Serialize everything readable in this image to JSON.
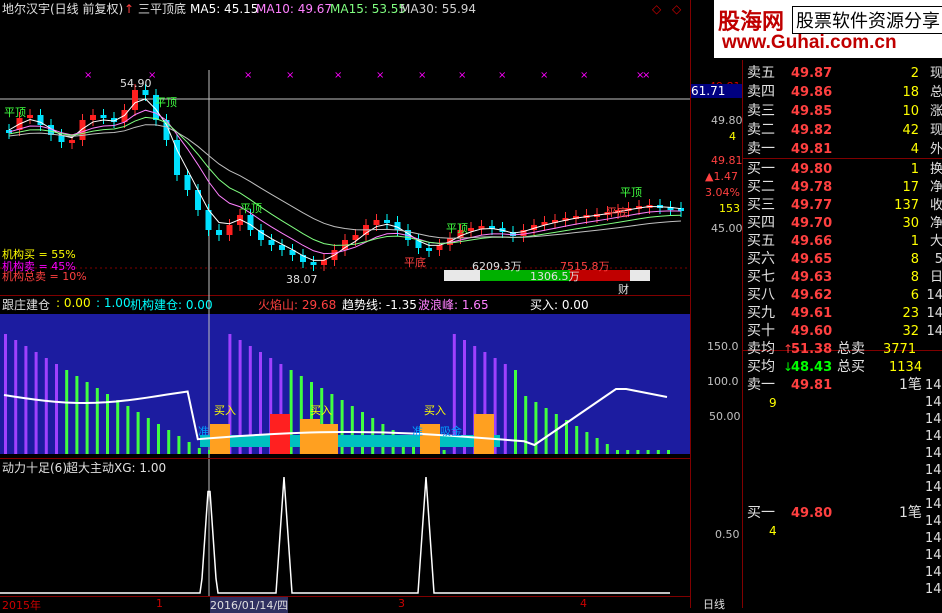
{
  "header": {
    "title": "地尔汉宇(日线 前复权)",
    "signal": "三平顶底",
    "ma5": "MA5: 45.15",
    "ma10": "MA10: 49.67",
    "ma15": "MA15: 53.55",
    "ma30": "MA30: 55.94"
  },
  "main_chart": {
    "high_label": "54.90",
    "low_label": "38.07",
    "pingding_label": "平顶",
    "pingdi_label": "平底",
    "inst_buy": "机构买 = 55%",
    "inst_sell": "机构卖 = 45%",
    "inst_total_sell": "机构总卖 = 10%",
    "bar_left": "6209.3万",
    "bar_mid": "1306.5万",
    "bar_right": "7515.8万",
    "cai_label": "财",
    "price_tag": "61.71"
  },
  "axis_main": [
    "49.80",
    "4",
    "49.81",
    "▲1.47",
    "3.04%",
    "153",
    "45.00"
  ],
  "indicator1": {
    "jianchang": "跟庄建仓",
    "v1": ": 0.00",
    "v2": ": 1.00",
    "jigou": "机构建仓: 0.00",
    "huoyan": "火焰山: 29.68",
    "qushi": "趋势线: -1.35",
    "bolang": "波浪峰: 1.65",
    "mairu": "买入: 0.00",
    "buy_tag": "买入",
    "zhun_tag": "准",
    "xijin_tag": "吸金",
    "axis": [
      "150.0",
      "100.0",
      "50.00"
    ]
  },
  "indicator2": {
    "title": "动力十足(6)",
    "xg": "超大主动XG: 1.00",
    "axis": [
      "0.50"
    ]
  },
  "xaxis": {
    "year": "2015年",
    "m1": "1",
    "date": "2016/01/14/四",
    "m3": "3",
    "m4": "4",
    "period": "日线"
  },
  "logo": {
    "text1": "股海网",
    "text2": "股票软件资源分享",
    "url": "www.Guhai.com.cn"
  },
  "quote": {
    "sell": [
      {
        "label": "卖五",
        "price": "49.87",
        "vol": "2",
        "edge": "现"
      },
      {
        "label": "卖四",
        "price": "49.86",
        "vol": "18",
        "edge": "总"
      },
      {
        "label": "卖三",
        "price": "49.85",
        "vol": "10",
        "edge": "涨"
      },
      {
        "label": "卖二",
        "price": "49.82",
        "vol": "42",
        "edge": "现"
      },
      {
        "label": "卖一",
        "price": "49.81",
        "vol": "4",
        "edge": "外"
      }
    ],
    "buy": [
      {
        "label": "买一",
        "price": "49.80",
        "vol": "1",
        "edge": "换"
      },
      {
        "label": "买二",
        "price": "49.78",
        "vol": "17",
        "edge": "净"
      },
      {
        "label": "买三",
        "price": "49.77",
        "vol": "137",
        "edge": "收"
      },
      {
        "label": "买四",
        "price": "49.70",
        "vol": "30",
        "edge": "净"
      },
      {
        "label": "买五",
        "price": "49.66",
        "vol": "1",
        "edge": "大"
      },
      {
        "label": "买六",
        "price": "49.65",
        "vol": "8",
        "edge": "5"
      },
      {
        "label": "买七",
        "price": "49.63",
        "vol": "8",
        "edge": "日"
      },
      {
        "label": "买八",
        "price": "49.62",
        "vol": "6",
        "edge": "14"
      },
      {
        "label": "买九",
        "price": "49.61",
        "vol": "23",
        "edge": "14"
      },
      {
        "label": "买十",
        "price": "49.60",
        "vol": "32",
        "edge": "14"
      }
    ],
    "avg_sell_label": "卖均",
    "avg_sell_price": "51.38",
    "total_sell_label": "总卖",
    "total_sell": "3771",
    "avg_buy_label": "买均",
    "avg_buy_price": "48.43",
    "total_buy_label": "总买",
    "total_buy": "1134",
    "sell1_label": "卖一",
    "sell1_price": "49.81",
    "sell1_count": "1笔",
    "sell1_vol": "9",
    "buy1_label": "买一",
    "buy1_price": "49.80",
    "buy1_count": "1笔",
    "buy1_vol": "4",
    "edge_times": [
      "14",
      "14",
      "14",
      "14",
      "14",
      "14",
      "14",
      "14",
      "14",
      "14",
      "14",
      "14",
      "14"
    ]
  },
  "colors": {
    "up": "#ff3030",
    "down": "#00ffff",
    "bg": "#000000",
    "grid": "#800000"
  }
}
